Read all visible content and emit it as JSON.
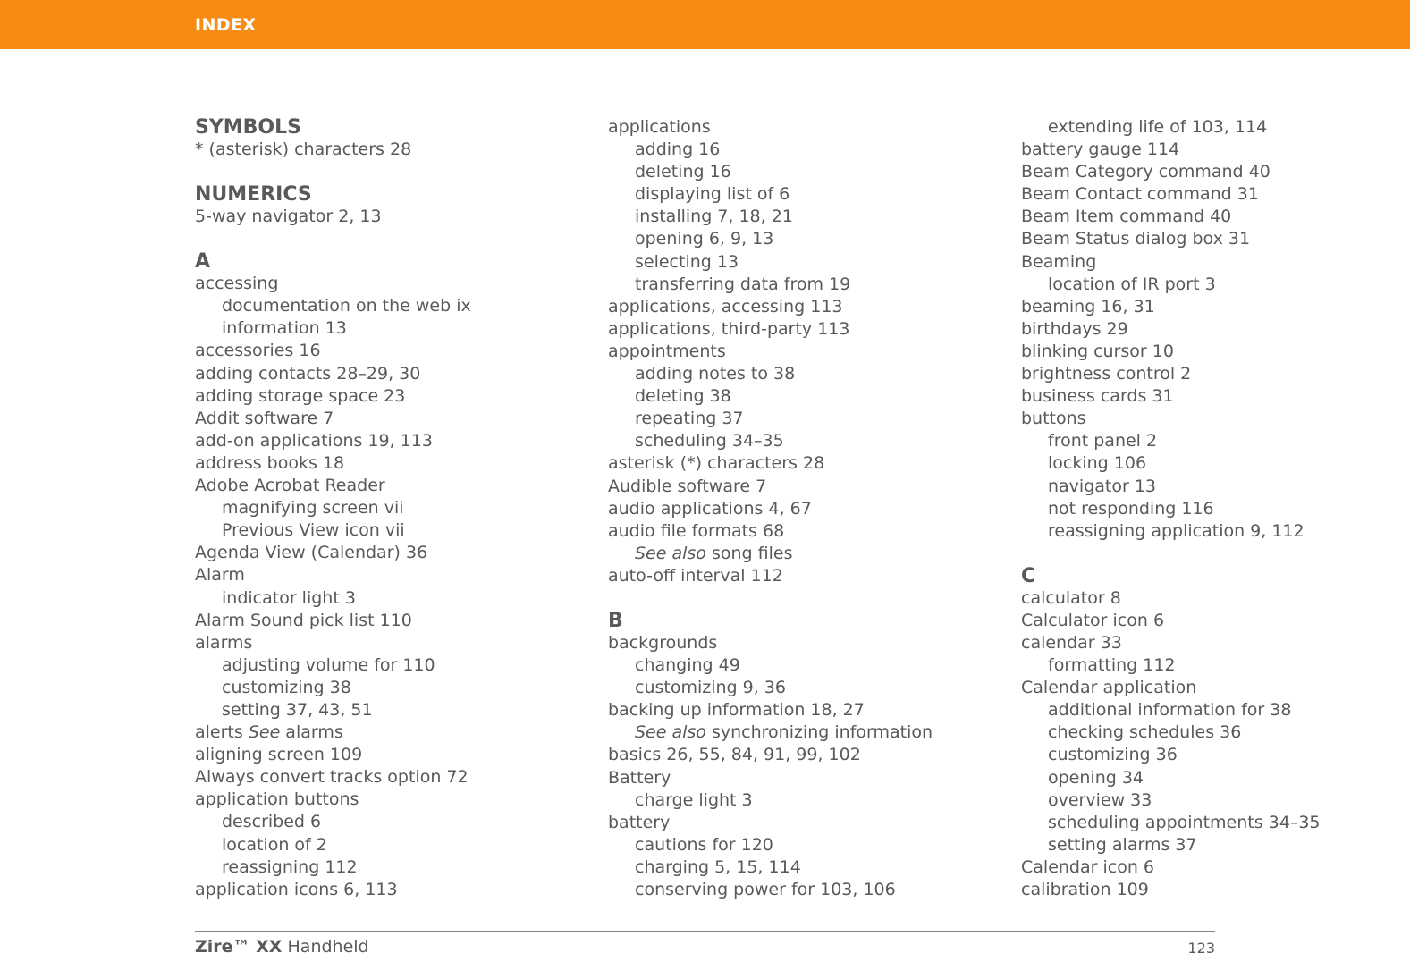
{
  "header": {
    "title": "INDEX",
    "band_color": "#f78c14",
    "title_color": "#ffffff"
  },
  "text_color": "#58595b",
  "columns": [
    {
      "blocks": [
        {
          "type": "section",
          "label": "SYMBOLS"
        },
        {
          "type": "entry",
          "text": "* (asterisk) characters 28"
        },
        {
          "type": "spacer"
        },
        {
          "type": "section",
          "label": "NUMERICS"
        },
        {
          "type": "entry",
          "text": "5-way navigator 2, 13"
        },
        {
          "type": "spacer"
        },
        {
          "type": "section",
          "label": "A"
        },
        {
          "type": "entry",
          "text": "accessing"
        },
        {
          "type": "sub",
          "text": "documentation on the web ix"
        },
        {
          "type": "sub",
          "text": "information 13"
        },
        {
          "type": "entry",
          "text": "accessories 16"
        },
        {
          "type": "entry",
          "text": "adding contacts 28–29, 30"
        },
        {
          "type": "entry",
          "text": "adding storage space 23"
        },
        {
          "type": "entry",
          "text": "Addit software 7"
        },
        {
          "type": "entry",
          "text": "add-on applications 19, 113"
        },
        {
          "type": "entry",
          "text": "address books 18"
        },
        {
          "type": "entry",
          "text": "Adobe Acrobat Reader"
        },
        {
          "type": "sub",
          "text": "magnifying screen vii"
        },
        {
          "type": "sub",
          "text": "Previous View icon vii"
        },
        {
          "type": "entry",
          "text": "Agenda View (Calendar) 36"
        },
        {
          "type": "entry",
          "text": "Alarm"
        },
        {
          "type": "sub",
          "text": "indicator light 3"
        },
        {
          "type": "entry",
          "text": "Alarm Sound pick list 110"
        },
        {
          "type": "entry",
          "text": "alarms"
        },
        {
          "type": "sub",
          "text": "adjusting volume for 110"
        },
        {
          "type": "sub",
          "text": "customizing 38"
        },
        {
          "type": "sub",
          "text": "setting 37, 43, 51"
        },
        {
          "type": "entry",
          "pre": "alerts ",
          "italic": "See",
          "post": " alarms"
        },
        {
          "type": "entry",
          "text": "aligning screen 109"
        },
        {
          "type": "entry",
          "text": "Always convert tracks option 72"
        },
        {
          "type": "entry",
          "text": "application buttons"
        },
        {
          "type": "sub",
          "text": "described 6"
        },
        {
          "type": "sub",
          "text": "location of 2"
        },
        {
          "type": "sub",
          "text": "reassigning 112"
        },
        {
          "type": "entry",
          "text": "application icons 6, 113"
        }
      ]
    },
    {
      "blocks": [
        {
          "type": "entry",
          "text": "applications"
        },
        {
          "type": "sub",
          "text": "adding 16"
        },
        {
          "type": "sub",
          "text": "deleting 16"
        },
        {
          "type": "sub",
          "text": "displaying list of 6"
        },
        {
          "type": "sub",
          "text": "installing 7, 18, 21"
        },
        {
          "type": "sub",
          "text": "opening 6, 9, 13"
        },
        {
          "type": "sub",
          "text": "selecting 13"
        },
        {
          "type": "sub",
          "text": "transferring data from 19"
        },
        {
          "type": "entry",
          "text": "applications, accessing 113"
        },
        {
          "type": "entry",
          "text": "applications, third-party 113"
        },
        {
          "type": "entry",
          "text": "appointments"
        },
        {
          "type": "sub",
          "text": "adding notes to 38"
        },
        {
          "type": "sub",
          "text": "deleting 38"
        },
        {
          "type": "sub",
          "text": "repeating 37"
        },
        {
          "type": "sub",
          "text": "scheduling 34–35"
        },
        {
          "type": "entry",
          "text": "asterisk (*) characters 28"
        },
        {
          "type": "entry",
          "text": "Audible software 7"
        },
        {
          "type": "entry",
          "text": "audio applications 4, 67"
        },
        {
          "type": "entry",
          "text": "audio file formats 68"
        },
        {
          "type": "sub",
          "italic": "See also",
          "post": " song files"
        },
        {
          "type": "entry",
          "text": "auto-off interval 112"
        },
        {
          "type": "spacer"
        },
        {
          "type": "section",
          "label": "B"
        },
        {
          "type": "entry",
          "text": "backgrounds"
        },
        {
          "type": "sub",
          "text": "changing 49"
        },
        {
          "type": "sub",
          "text": "customizing 9, 36"
        },
        {
          "type": "entry",
          "text": "backing up information 18, 27"
        },
        {
          "type": "sub",
          "italic": "See also",
          "post": " synchronizing information"
        },
        {
          "type": "entry",
          "text": "basics 26, 55, 84, 91, 99, 102"
        },
        {
          "type": "entry",
          "text": "Battery"
        },
        {
          "type": "sub",
          "text": "charge light 3"
        },
        {
          "type": "entry",
          "text": "battery"
        },
        {
          "type": "sub",
          "text": "cautions for 120"
        },
        {
          "type": "sub",
          "text": "charging 5, 15, 114"
        },
        {
          "type": "sub",
          "text": "conserving power for 103, 106"
        }
      ]
    },
    {
      "blocks": [
        {
          "type": "sub",
          "text": "extending life of 103, 114"
        },
        {
          "type": "entry",
          "text": "battery gauge 114"
        },
        {
          "type": "entry",
          "text": "Beam Category command 40"
        },
        {
          "type": "entry",
          "text": "Beam Contact command 31"
        },
        {
          "type": "entry",
          "text": "Beam Item command 40"
        },
        {
          "type": "entry",
          "text": "Beam Status dialog box 31"
        },
        {
          "type": "entry",
          "text": "Beaming"
        },
        {
          "type": "sub",
          "text": "location of IR port 3"
        },
        {
          "type": "entry",
          "text": "beaming 16, 31"
        },
        {
          "type": "entry",
          "text": "birthdays 29"
        },
        {
          "type": "entry",
          "text": "blinking cursor 10"
        },
        {
          "type": "entry",
          "text": "brightness control 2"
        },
        {
          "type": "entry",
          "text": "business cards 31"
        },
        {
          "type": "entry",
          "text": "buttons"
        },
        {
          "type": "sub",
          "text": "front panel 2"
        },
        {
          "type": "sub",
          "text": "locking 106"
        },
        {
          "type": "sub",
          "text": "navigator 13"
        },
        {
          "type": "sub",
          "text": "not responding 116"
        },
        {
          "type": "sub",
          "text": "reassigning application 9, 112"
        },
        {
          "type": "spacer"
        },
        {
          "type": "section",
          "label": "C"
        },
        {
          "type": "entry",
          "text": "calculator 8"
        },
        {
          "type": "entry",
          "text": "Calculator icon 6"
        },
        {
          "type": "entry",
          "text": "calendar 33"
        },
        {
          "type": "sub",
          "text": "formatting 112"
        },
        {
          "type": "entry",
          "text": "Calendar application"
        },
        {
          "type": "sub",
          "text": "additional information for 38"
        },
        {
          "type": "sub",
          "text": "checking schedules 36"
        },
        {
          "type": "sub",
          "text": "customizing 36"
        },
        {
          "type": "sub",
          "text": "opening 34"
        },
        {
          "type": "sub",
          "text": "overview 33"
        },
        {
          "type": "sub",
          "text": "scheduling appointments 34–35"
        },
        {
          "type": "sub",
          "text": "setting alarms 37"
        },
        {
          "type": "entry",
          "text": "Calendar icon 6"
        },
        {
          "type": "entry",
          "text": "calibration 109"
        }
      ]
    }
  ],
  "footer": {
    "product_bold": "Zire™  XX",
    "product_rest": " Handheld",
    "page_number": "123",
    "rule_color": "#808285"
  }
}
